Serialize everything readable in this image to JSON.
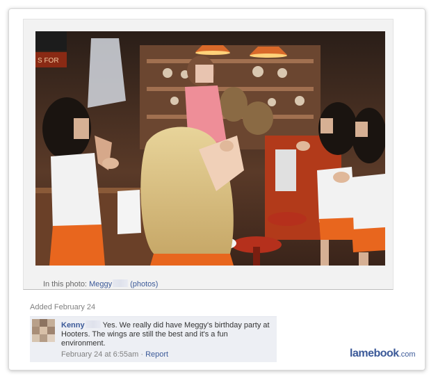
{
  "photo": {
    "alt": "Photo of a birthday party at Hooters",
    "store_sign": "S FOR"
  },
  "caption": {
    "prefix": "In this photo:",
    "tagged_name": "Meggy",
    "photos_link": "(photos)"
  },
  "added_label": "Added February 24",
  "comment": {
    "author": "Kenny",
    "text": "Yes. We really did have Meggy's birthday party at Hooters. The wings are still the best and it's a fun environment.",
    "timestamp": "February 24 at 6:55am",
    "separator": "·",
    "report_label": "Report"
  },
  "watermark": {
    "name": "lamebook",
    "tld": ".com"
  },
  "colors": {
    "link": "#3b5998",
    "comment_bg": "#edeff4",
    "uniform_orange": "#e8661e"
  },
  "icons": [
    "avatar-blurred"
  ]
}
